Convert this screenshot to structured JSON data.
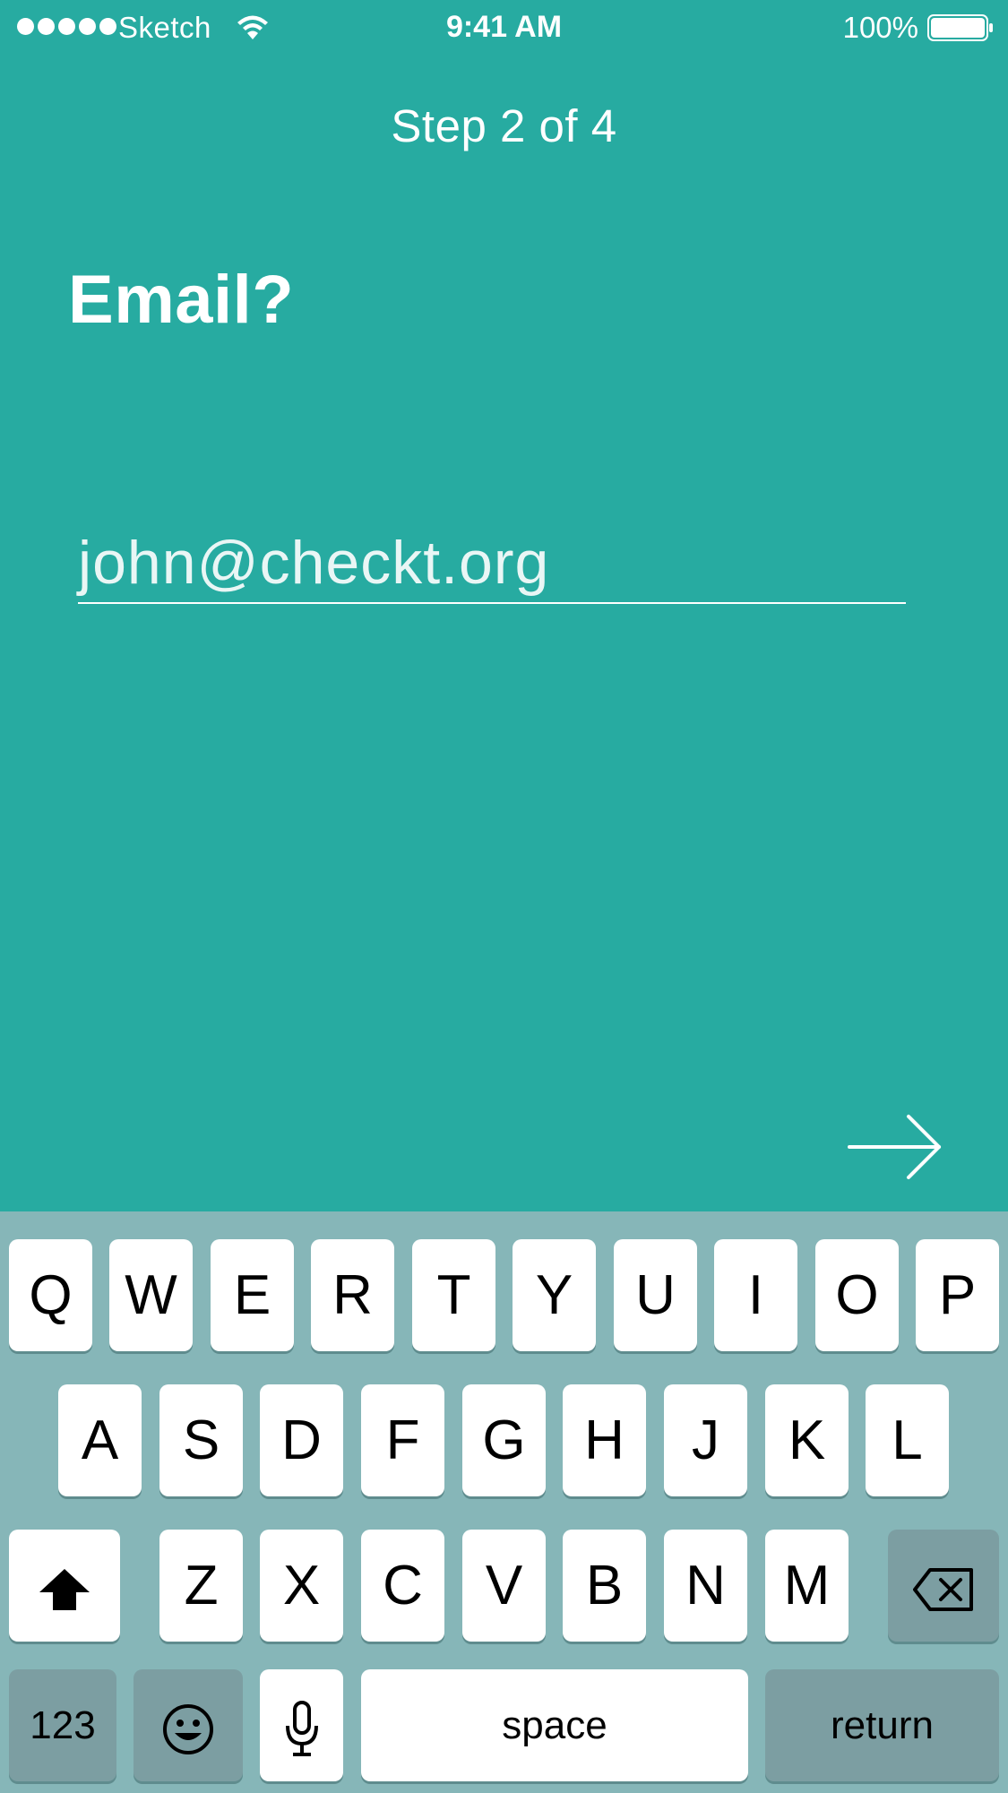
{
  "status_bar": {
    "carrier": "Sketch",
    "time": "9:41 AM",
    "battery": "100%",
    "signal_icon": "signal-dots-icon",
    "wifi_icon": "wifi-icon",
    "battery_icon": "battery-full-icon"
  },
  "onboarding": {
    "step": "Step 2 of 4",
    "question": "Email?",
    "email_value": "john@checkt.org",
    "next_icon": "arrow-right-icon"
  },
  "keyboard": {
    "row1": [
      "Q",
      "W",
      "E",
      "R",
      "T",
      "Y",
      "U",
      "I",
      "O",
      "P"
    ],
    "row2": [
      "A",
      "S",
      "D",
      "F",
      "G",
      "H",
      "J",
      "K",
      "L"
    ],
    "row3": [
      "Z",
      "X",
      "C",
      "V",
      "B",
      "N",
      "M"
    ],
    "numbers_label": "123",
    "space_label": "space",
    "return_label": "return",
    "shift_icon": "shift-icon",
    "delete_icon": "backspace-icon",
    "emoji_icon": "emoji-icon",
    "mic_icon": "microphone-icon"
  },
  "colors": {
    "background": "#27aba1",
    "keyboard": "#86b6b8",
    "key": "#ffffff",
    "special_key": "#7c9ea2"
  }
}
